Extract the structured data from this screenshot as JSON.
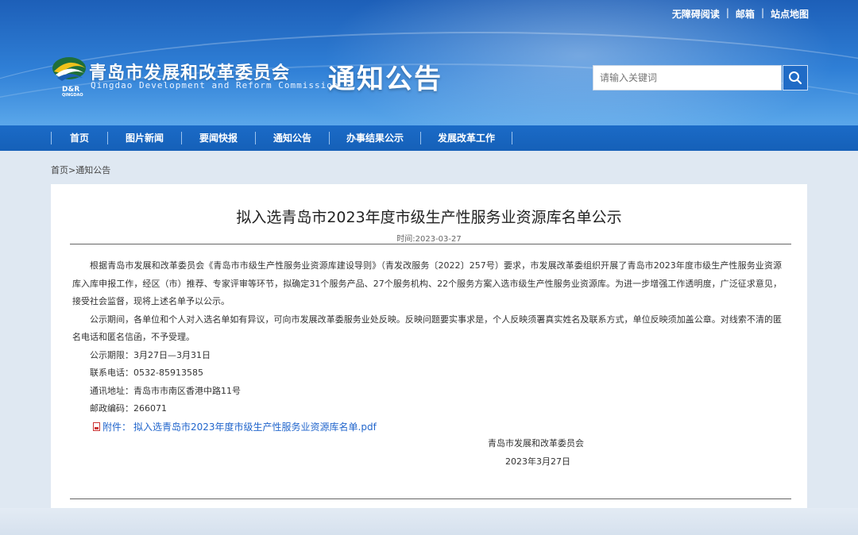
{
  "top_links": [
    "无障碍阅读",
    "邮箱",
    "站点地图"
  ],
  "logo": {
    "text": "D&R",
    "subtext": "QINGDAO"
  },
  "site": {
    "name": "青岛市发展和改革委员会",
    "name_en": "Qingdao Development and Reform Commission"
  },
  "section_title": "通知公告",
  "search": {
    "placeholder": "请输入关键词",
    "button_icon": "search-icon"
  },
  "nav": {
    "items": [
      {
        "label": "首页"
      },
      {
        "label": "图片新闻"
      },
      {
        "label": "要闻快报"
      },
      {
        "label": "通知公告"
      },
      {
        "label": "办事结果公示"
      },
      {
        "label": "发展改革工作"
      }
    ]
  },
  "breadcrumb": {
    "home": "首页",
    "sep": ">",
    "current": "通知公告"
  },
  "article": {
    "title": "拟入选青岛市2023年度市级生产性服务业资源库名单公示",
    "date": "时间:2023-03-27",
    "para1": "根据青岛市发展和改革委员会《青岛市市级生产性服务业资源库建设导则》（青发改服务〔2022〕257号）要求，市发展改革委组织开展了青岛市2023年度市级生产性服务业资源库入库申报工作，经区（市）推荐、专家评审等环节，拟确定31个服务产品、27个服务机构、22个服务方案入选市级生产性服务业资源库。为进一步增强工作透明度，广泛征求意见，接受社会监督，现将上述名单予以公示。",
    "para2": "公示期间，各单位和个人对入选名单如有异议，可向市发展改革委服务业处反映。反映问题要实事求是，个人反映须署真实姓名及联系方式，单位反映须加盖公章。对线索不清的匿名电话和匿名信函，不予受理。",
    "period": "公示期限：3月27日—3月31日",
    "phone": "联系电话：0532-85913585",
    "address": "通讯地址：青岛市市南区香港中路11号",
    "postcode": "邮政编码：266071",
    "attachment_label": "附件：",
    "attachment_name": "拟入选青岛市2023年度市级生产性服务业资源库名单.pdf",
    "signature_org": "青岛市发展和改革委员会",
    "signature_date": "2023年3月27日"
  },
  "colors": {
    "header_blue": "#1d5fb8",
    "nav_blue": "#1b6bc7",
    "link_blue": "#2266cc",
    "page_bg": "#dfe8f2"
  }
}
